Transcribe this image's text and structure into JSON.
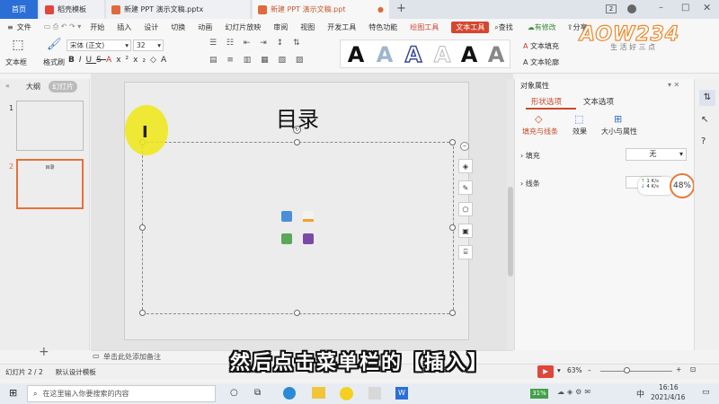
{
  "tabs": {
    "home": "首页",
    "template": "稻壳模板",
    "file1": "新建 PPT 演示文稿.pptx",
    "file2": "新建 PPT 演示文稿.ppt",
    "add": "+"
  },
  "window": {
    "badge": "2"
  },
  "menu": {
    "file": "文件",
    "start": "开始",
    "insert": "插入",
    "design": "设计",
    "switch": "切换",
    "animation": "动画",
    "slideshow": "幻灯片放映",
    "review": "审阅",
    "view": "视图",
    "devtools": "开发工具",
    "features": "特色功能",
    "drawing": "绘图工具",
    "text_tool": "文本工具",
    "search": "查找",
    "unmodified": "有修改",
    "share": "分享"
  },
  "ribbon": {
    "textbox": "文本框",
    "format_painter": "格式刷",
    "font_name": "宋体 (正文)",
    "font_size": "32",
    "text_fill": "文本填充",
    "text_outline": "文本轮廓",
    "wordart_glyph": "A"
  },
  "left_panel": {
    "outline": "大纲",
    "slides": "幻灯片",
    "slide1_no": "1",
    "slide2_no": "2",
    "slide2_title": "目录",
    "add": "+"
  },
  "slide": {
    "title": "目录"
  },
  "notes": {
    "placeholder": "单击此处添加备注"
  },
  "right_panel": {
    "title": "对象属性",
    "tab_shape": "形状选项",
    "tab_text": "文本选项",
    "sub_fill_line": "填充与线条",
    "sub_effect": "效果",
    "sub_size": "大小与属性",
    "fill_label": "填充",
    "fill_value": "无",
    "line_label": "线条"
  },
  "net": {
    "up": "1",
    "down": "4",
    "unit": "K/s",
    "cpu": "48%"
  },
  "status": {
    "slide": "幻灯片 2 / 2",
    "template": "默认设计模板",
    "zoom": "63%"
  },
  "taskbar": {
    "search": "在这里输入你要搜索的内容",
    "battery": "31%",
    "lang": "中",
    "time": "16:16",
    "date": "2021/4/16"
  },
  "subtitle": "然后点击菜单栏的【插入】",
  "watermark": {
    "brand": "AOW234",
    "slogan": "生 活 好 三 点"
  }
}
